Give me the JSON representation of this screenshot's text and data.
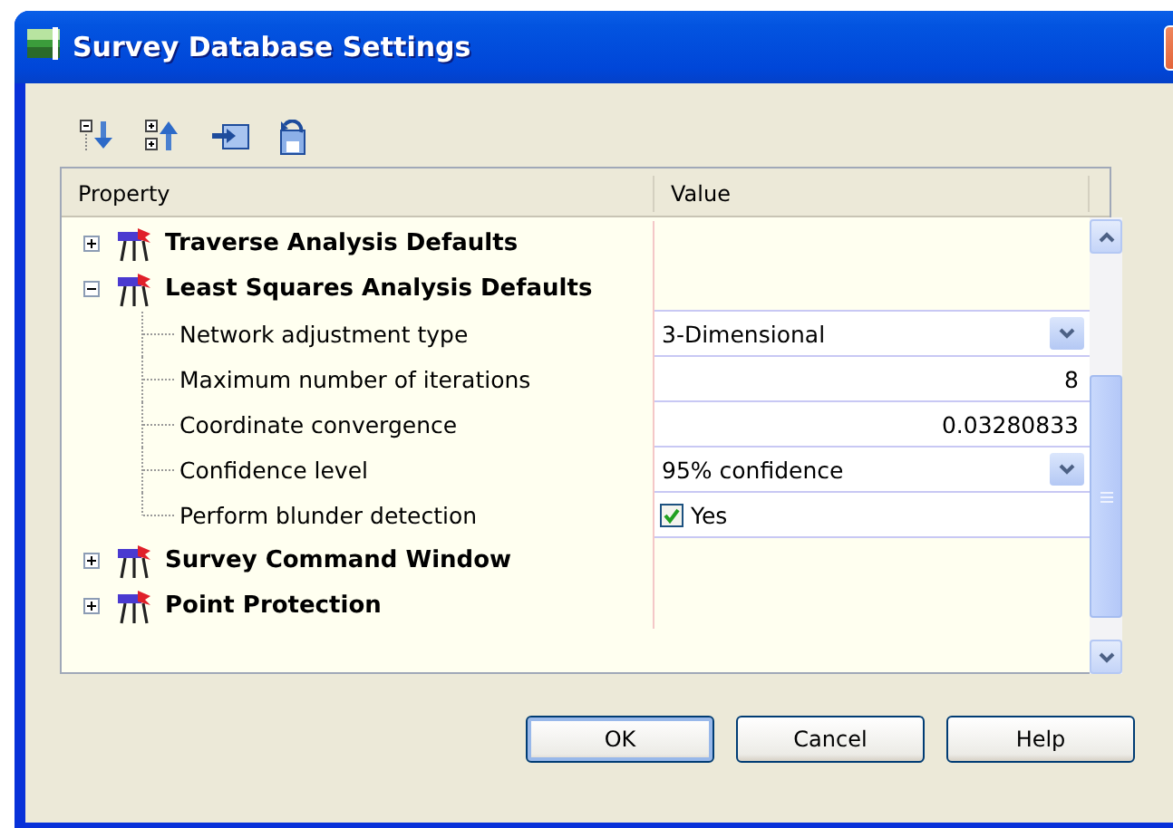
{
  "window": {
    "title": "Survey Database Settings"
  },
  "grid": {
    "columns": [
      "Property",
      "Value"
    ],
    "categories": [
      {
        "label": "Traverse Analysis Defaults",
        "expanded": false
      },
      {
        "label": "Least Squares Analysis Defaults",
        "expanded": true,
        "children": [
          {
            "label": "Network adjustment type",
            "kind": "dropdown",
            "value": "3-Dimensional"
          },
          {
            "label": "Maximum number of iterations",
            "kind": "number",
            "value": "8"
          },
          {
            "label": "Coordinate convergence",
            "kind": "number",
            "value": "0.03280833"
          },
          {
            "label": "Confidence level",
            "kind": "dropdown",
            "value": "95% confidence"
          },
          {
            "label": "Perform blunder detection",
            "kind": "checkbox",
            "value": "Yes",
            "checked": true
          }
        ]
      },
      {
        "label": "Survey Command Window",
        "expanded": false
      },
      {
        "label": "Point Protection",
        "expanded": false
      }
    ]
  },
  "buttons": [
    {
      "label": "OK",
      "default": true
    },
    {
      "label": "Cancel",
      "default": false
    },
    {
      "label": "Help",
      "default": false
    }
  ]
}
